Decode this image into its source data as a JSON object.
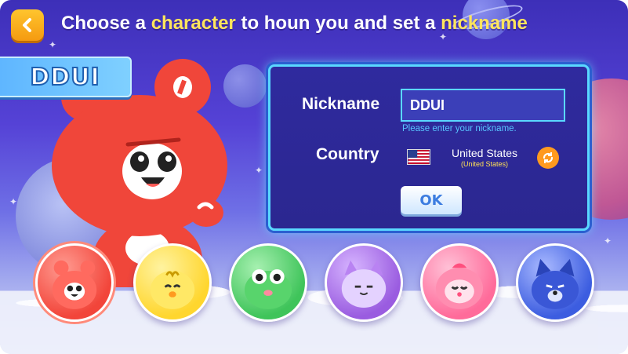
{
  "header": {
    "title_part1": "Choose a ",
    "title_highlight1": "character",
    "title_part2": " to houn you and set a ",
    "title_highlight2": "nickname"
  },
  "character_name": "DDUI",
  "form": {
    "nickname_label": "Nickname",
    "nickname_value": "DDUI",
    "nickname_hint": "Please enter your nickname.",
    "country_label": "Country",
    "country_name": "United States",
    "country_sub": "(United States)",
    "ok_label": "OK"
  },
  "characters": [
    {
      "id": "red-bear",
      "color": "#f2453a",
      "selected": true
    },
    {
      "id": "yellow-chick",
      "color": "#ffd62e",
      "selected": false
    },
    {
      "id": "green-frog",
      "color": "#3fc45a",
      "selected": false
    },
    {
      "id": "purple-cat",
      "color": "#9a5ce0",
      "selected": false
    },
    {
      "id": "pink-bunny",
      "color": "#ff6b9a",
      "selected": false
    },
    {
      "id": "blue-wolf",
      "color": "#3c5de0",
      "selected": false
    }
  ],
  "colors": {
    "accent_yellow": "#ffe55c",
    "panel_border": "#5ad8ff",
    "button_orange": "#f59a10"
  },
  "icons": {
    "back": "chevron-left-icon",
    "refresh": "refresh-icon",
    "flag": "us-flag-icon"
  }
}
